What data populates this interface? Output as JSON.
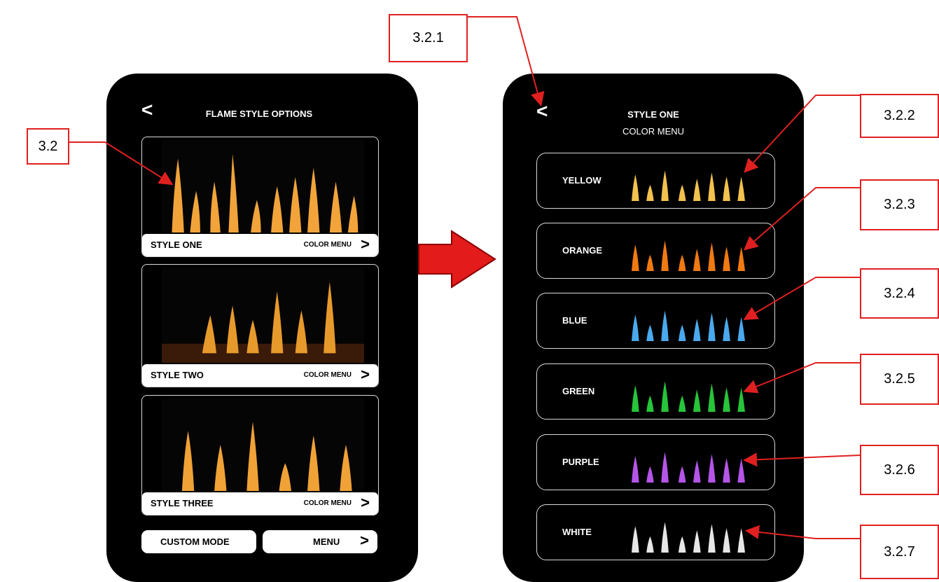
{
  "left_screen": {
    "back_label": "<",
    "title": "FLAME STYLE OPTIONS",
    "styles": [
      {
        "name": "STYLE ONE",
        "color_menu": "COLOR MENU",
        "chevron": ">"
      },
      {
        "name": "STYLE TWO",
        "color_menu": "COLOR MENU",
        "chevron": ">"
      },
      {
        "name": "STYLE THREE",
        "color_menu": "COLOR MENU",
        "chevron": ">"
      }
    ],
    "custom_mode": "CUSTOM MODE",
    "menu": "MENU",
    "menu_chevron": ">"
  },
  "right_screen": {
    "back_label": "<",
    "title": "STYLE ONE",
    "subtitle": "COLOR MENU",
    "colors": [
      {
        "label": "YELLOW",
        "flame_color": "#f2c14e"
      },
      {
        "label": "ORANGE",
        "flame_color": "#f07a12"
      },
      {
        "label": "BLUE",
        "flame_color": "#4aa9ee"
      },
      {
        "label": "GREEN",
        "flame_color": "#27c43a"
      },
      {
        "label": "PURPLE",
        "flame_color": "#b455e8"
      },
      {
        "label": "WHITE",
        "flame_color": "#e6e6e6"
      }
    ]
  },
  "callouts": [
    "3.2",
    "3.2.1",
    "3.2.2",
    "3.2.3",
    "3.2.4",
    "3.2.5",
    "3.2.6",
    "3.2.7"
  ],
  "colors": {
    "annotation": "#e02020",
    "arrow": "#e31b1b",
    "card_border": "#d9d9d9"
  }
}
